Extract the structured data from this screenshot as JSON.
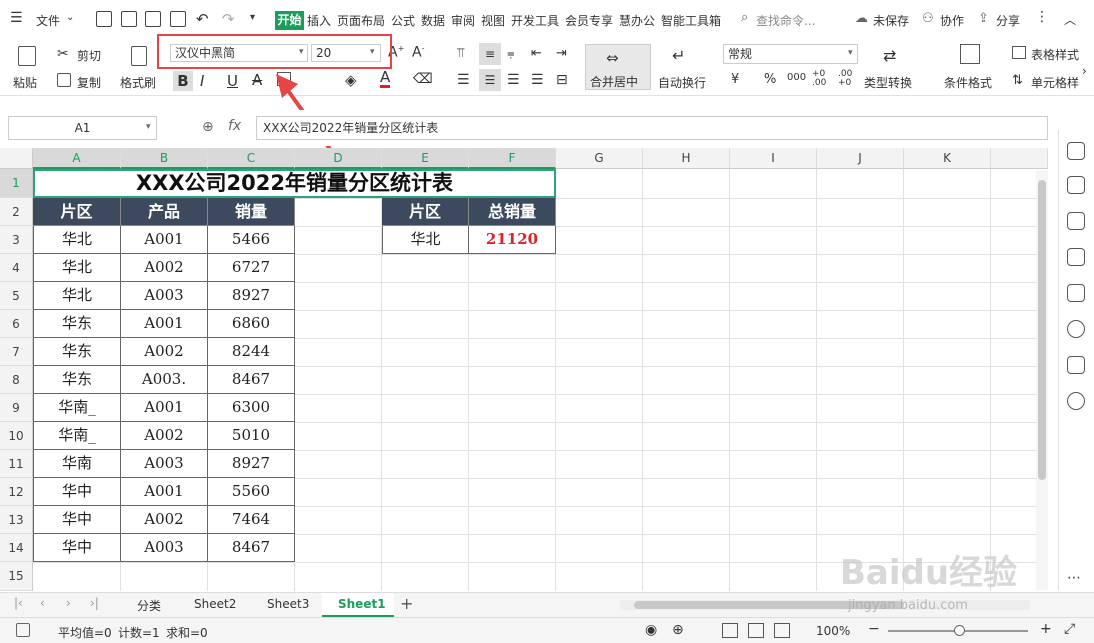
{
  "menu": {
    "file_label": "文件",
    "tabs": [
      "开始",
      "插入",
      "页面布局",
      "公式",
      "数据",
      "审阅",
      "视图",
      "开发工具",
      "会员专享",
      "慧办公",
      "智能工具箱"
    ],
    "search_placeholder": "查找命令...",
    "unsaved_label": "未保存",
    "collab_label": "协作",
    "share_label": "分享"
  },
  "ribbon": {
    "paste_label": "粘贴",
    "cut_label": "剪切",
    "copy_label": "复制",
    "format_painter_label": "格式刷",
    "font_name": "汉仪中黑简",
    "font_size": "20",
    "bold": "B",
    "italic": "I",
    "underline": "U",
    "merge_label": "合并居中",
    "wrap_label": "自动换行",
    "number_format": "常规",
    "type_convert_label": "类型转换",
    "cond_format_label": "条件格式",
    "table_style_label": "表格样式",
    "cell_style_label": "单元格样"
  },
  "formula_bar": {
    "name_box": "A1",
    "fx": "fx",
    "content": "XXX公司2022年销量分区统计表"
  },
  "sheet": {
    "columns": [
      "A",
      "B",
      "C",
      "D",
      "E",
      "F",
      "G",
      "H",
      "I",
      "J",
      "K"
    ],
    "rows": [
      "1",
      "2",
      "3",
      "4",
      "5",
      "6",
      "7",
      "8",
      "9",
      "10",
      "11",
      "12",
      "13",
      "14",
      "15"
    ],
    "title": "XXX公司2022年销量分区统计表",
    "headers": [
      "片区",
      "产品",
      "销量"
    ],
    "data": [
      [
        "华北",
        "A001",
        "5466"
      ],
      [
        "华北",
        "A002",
        "6727"
      ],
      [
        "华北",
        "A003",
        "8927"
      ],
      [
        "华东",
        "A001",
        "6860"
      ],
      [
        "华东",
        "A002",
        "8244"
      ],
      [
        "华东",
        "A003.",
        "8467"
      ],
      [
        "华南_",
        "A001",
        "6300"
      ],
      [
        "华南_",
        "A002",
        "5010"
      ],
      [
        "华南",
        "A003",
        "8927"
      ],
      [
        "华中",
        "A001",
        "5560"
      ],
      [
        "华中",
        "A002",
        "7464"
      ],
      [
        "华中",
        "A003",
        "8467"
      ]
    ],
    "summary_headers": [
      "片区",
      "总销量"
    ],
    "summary_row": [
      "华北",
      "21120"
    ],
    "header_bg": "#3d4a5e",
    "accent_green": "#1b9e5b",
    "summary_value_color": "#e0202a"
  },
  "tabs": {
    "sheets": [
      "分类",
      "Sheet2",
      "Sheet3",
      "Sheet1"
    ],
    "active": "Sheet1",
    "add": "+"
  },
  "status": {
    "average": "平均值=0",
    "count": "计数=1",
    "sum": "求和=0",
    "zoom": "100%"
  },
  "watermark": {
    "brand": "Baidu经验",
    "url": "jingyan.baidu.com"
  }
}
